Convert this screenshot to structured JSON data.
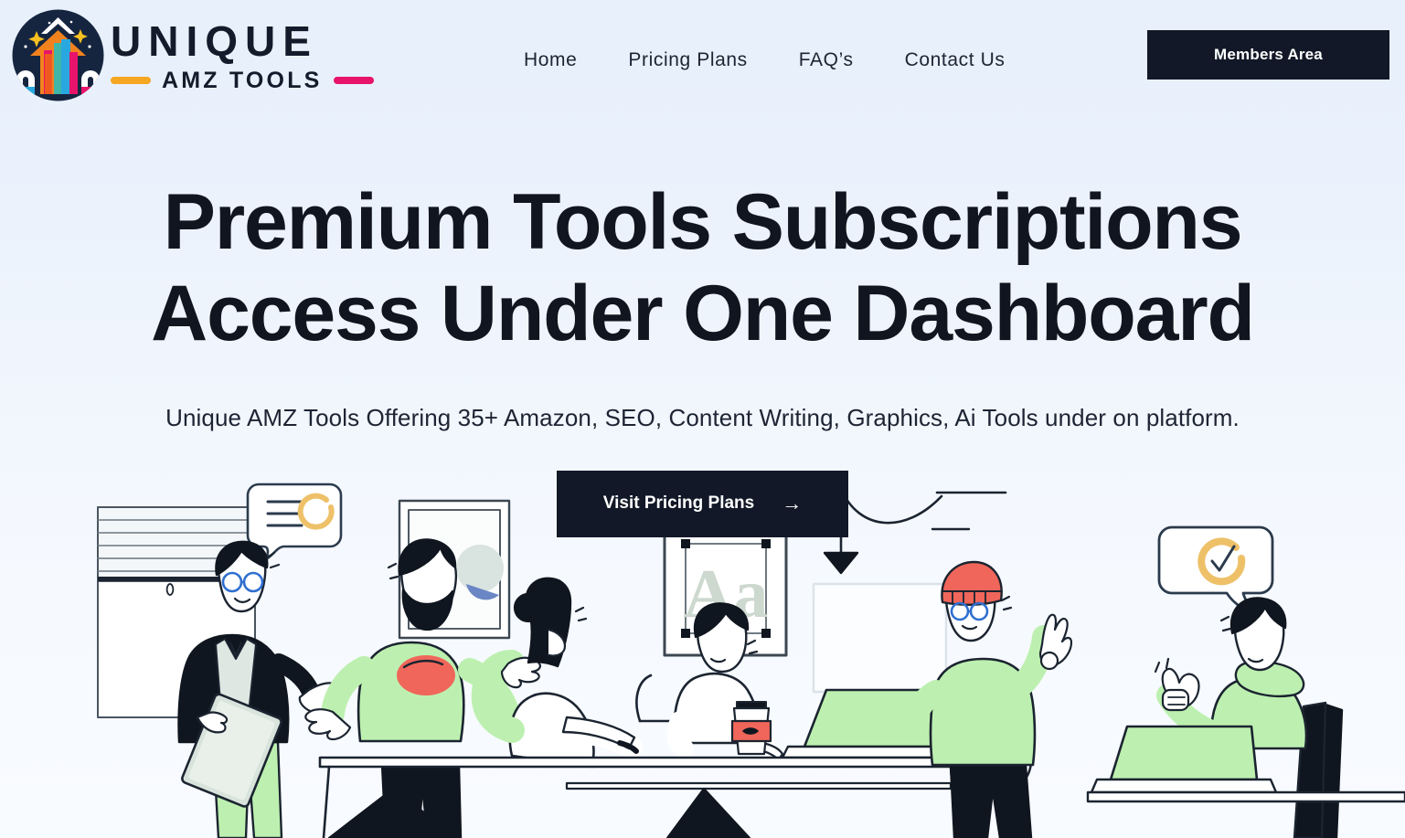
{
  "brand": {
    "name": "UNIQUE",
    "subtitle": "AMZ TOOLS",
    "logo_icon": "growth-chart-badge-icon",
    "colors": {
      "dash_left": "#f5a623",
      "dash_right": "#e8136b",
      "logo_circle": "#16253f",
      "logo_arrow": "#f2821e",
      "logo_bar_cyan": "#29a8e0",
      "logo_bar_magenta": "#e8136b",
      "logo_star": "#f7c020"
    }
  },
  "nav": {
    "items": [
      {
        "label": "Home"
      },
      {
        "label": "Pricing Plans"
      },
      {
        "label": "FAQ’s"
      },
      {
        "label": "Contact Us"
      }
    ],
    "members_button": "Members Area"
  },
  "hero": {
    "heading_line1": "Premium Tools Subscriptions",
    "heading_line2": "Access Under One Dashboard",
    "subtitle": "Unique AMZ Tools Offering 35+ Amazon, SEO, Content Writing, Graphics, Ai Tools under on platform.",
    "cta_label": "Visit Pricing Plans",
    "cta_arrow": "→",
    "bg_color_top": "#e7f0fb",
    "bg_color_bottom": "#f8fbff",
    "text_color": "#11151f",
    "button_color": "#121827"
  },
  "illustration": {
    "name": "office-team-collaboration-illustration",
    "palette": {
      "line": "#1b2430",
      "mint": "#bdf0b0",
      "coral": "#f0665a",
      "amber": "#eec169",
      "blue": "#2f6fd0",
      "paper": "#ffffff",
      "gray": "#c8d2d0"
    },
    "elements": [
      {
        "name": "window-blinds",
        "label": "window with blinds"
      },
      {
        "name": "speech-bubble-lines-spinner",
        "label": "chat bubble with lines and loading spinner"
      },
      {
        "name": "person-presenter-suit",
        "label": "man in suit with glasses holding tablet"
      },
      {
        "name": "person-bearded-green-shirt",
        "label": "bearded man in mint shirt gesturing"
      },
      {
        "name": "framed-poster-aa",
        "label": "framed Aa typography poster"
      },
      {
        "name": "person-seated-back",
        "label": "woman seated with back to viewer"
      },
      {
        "name": "person-at-desk-coffee",
        "label": "man at desk with coffee cup"
      },
      {
        "name": "coffee-cup",
        "label": "takeaway coffee cup with coral sleeve"
      },
      {
        "name": "laptop-green-screen",
        "label": "open laptop with mint screen"
      },
      {
        "name": "pendant-lamp",
        "label": "hanging pendant lamp"
      },
      {
        "name": "whiteboard",
        "label": "blank whiteboard on wall"
      },
      {
        "name": "person-red-beanie-ok-gesture",
        "label": "person in red beanie making OK sign"
      },
      {
        "name": "speech-bubble-check",
        "label": "chat bubble with amber check circle"
      },
      {
        "name": "person-thumbs-up-laptop",
        "label": "man at laptop giving thumbs up"
      }
    ]
  }
}
